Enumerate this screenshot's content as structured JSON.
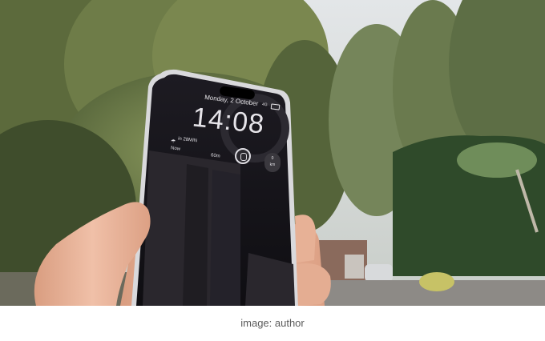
{
  "caption": "image: author",
  "lock_screen": {
    "date": "Monday, 2 October",
    "time": "14:08",
    "weather_text": "in 28MIN",
    "timeline_now": "Now",
    "timeline_end": "60m",
    "widget_value": "0",
    "widget_unit": "km",
    "network": "4G"
  },
  "colors": {
    "sky": "#d4d9db",
    "foliage": "#5f7046",
    "hedge": "#2f4a2a",
    "skin": "#e9b49a",
    "phone_screen": "#16141a",
    "phone_frame": "#d9d9dc"
  }
}
